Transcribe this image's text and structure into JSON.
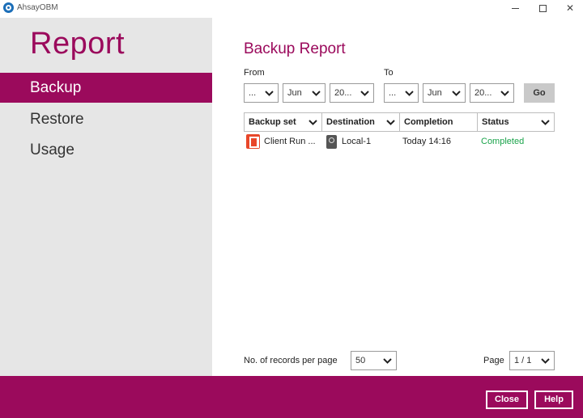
{
  "window": {
    "title": "AhsayOBM"
  },
  "sidebar": {
    "title": "Report",
    "items": [
      {
        "label": "Backup",
        "active": true
      },
      {
        "label": "Restore",
        "active": false
      },
      {
        "label": "Usage",
        "active": false
      }
    ]
  },
  "main": {
    "title": "Backup Report",
    "from_label": "From",
    "to_label": "To",
    "from": {
      "day": "...",
      "month": "Jun",
      "year": "20..."
    },
    "to": {
      "day": "...",
      "month": "Jun",
      "year": "20..."
    },
    "go_label": "Go",
    "table": {
      "columns": [
        "Backup set",
        "Destination",
        "Completion",
        "Status"
      ],
      "rows": [
        {
          "backup_set": "Client Run ...",
          "destination": "Local-1",
          "completion": "Today 14:16",
          "status": "Completed"
        }
      ]
    },
    "records_label": "No. of records per page",
    "records_value": "50",
    "page_label": "Page",
    "page_value": "1 / 1"
  },
  "footer": {
    "close_label": "Close",
    "help_label": "Help"
  },
  "colors": {
    "brand": "#9b0a5c",
    "status_ok": "#1aa34a",
    "sidebar_bg": "#e6e6e6"
  },
  "icons": [
    "ahsay-logo-icon",
    "office365-icon",
    "local-drive-icon",
    "chevron-down-icon"
  ]
}
